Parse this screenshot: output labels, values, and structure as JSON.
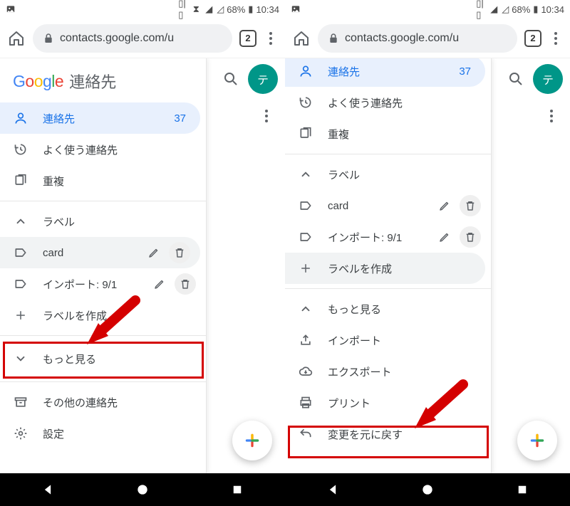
{
  "status": {
    "battery": "68%",
    "time": "10:34"
  },
  "browser": {
    "url": "contacts.google.com/u",
    "tab_count": "2"
  },
  "avatar_initial": "テ",
  "logo_text": "Google",
  "app_title": "連絡先",
  "left": {
    "contacts": {
      "label": "連絡先",
      "count": "37"
    },
    "frequent": {
      "label": "よく使う連絡先"
    },
    "duplicates": {
      "label": "重複"
    },
    "label_header": "ラベル",
    "labels": [
      {
        "name": "card"
      },
      {
        "name": "インポート: 9/1"
      }
    ],
    "more": "もっと見る",
    "create_label": "ラベルを作成",
    "other_contacts": "その他の連絡先",
    "settings": "設定"
  },
  "right": {
    "contacts": {
      "label": "連絡先",
      "count": "37"
    },
    "frequent": {
      "label": "よく使う連絡先"
    },
    "duplicates": {
      "label": "重複"
    },
    "label_header": "ラベル",
    "labels": [
      {
        "name": "card"
      },
      {
        "name": "インポート: 9/1"
      }
    ],
    "create_label": "ラベルを作成",
    "more": "もっと見る",
    "import": "インポート",
    "export": "エクスポート",
    "print": "プリント",
    "undo": "変更を元に戻す"
  }
}
